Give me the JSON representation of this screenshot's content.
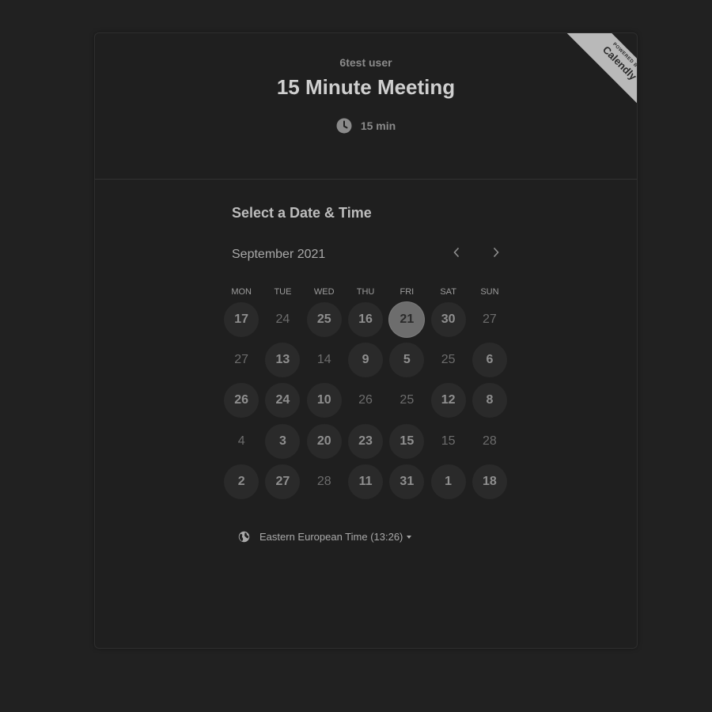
{
  "header": {
    "host_name": "6test user",
    "event_title": "15 Minute Meeting",
    "duration": "15 min",
    "duration_icon": "clock-icon"
  },
  "badge": {
    "small_text": "POWERED BY",
    "brand": "Calendly"
  },
  "scheduler": {
    "section_title": "Select a Date & Time",
    "month_label": "September 2021",
    "prev_icon": "chevron-left-icon",
    "next_icon": "chevron-right-icon",
    "weekdays": [
      "MON",
      "TUE",
      "WED",
      "THU",
      "FRI",
      "SAT",
      "SUN"
    ],
    "weeks": [
      [
        {
          "label": "17",
          "state": "available"
        },
        {
          "label": "24",
          "state": "unavailable"
        },
        {
          "label": "25",
          "state": "available"
        },
        {
          "label": "16",
          "state": "available"
        },
        {
          "label": "21",
          "state": "selected"
        },
        {
          "label": "30",
          "state": "available"
        },
        {
          "label": "27",
          "state": "unavailable"
        }
      ],
      [
        {
          "label": "27",
          "state": "unavailable"
        },
        {
          "label": "13",
          "state": "available"
        },
        {
          "label": "14",
          "state": "unavailable"
        },
        {
          "label": "9",
          "state": "available"
        },
        {
          "label": "5",
          "state": "available"
        },
        {
          "label": "25",
          "state": "unavailable"
        },
        {
          "label": "6",
          "state": "available"
        }
      ],
      [
        {
          "label": "26",
          "state": "available"
        },
        {
          "label": "24",
          "state": "available"
        },
        {
          "label": "10",
          "state": "available"
        },
        {
          "label": "26",
          "state": "unavailable"
        },
        {
          "label": "25",
          "state": "unavailable"
        },
        {
          "label": "12",
          "state": "available"
        },
        {
          "label": "8",
          "state": "available"
        }
      ],
      [
        {
          "label": "4",
          "state": "unavailable"
        },
        {
          "label": "3",
          "state": "available"
        },
        {
          "label": "20",
          "state": "available"
        },
        {
          "label": "23",
          "state": "available"
        },
        {
          "label": "15",
          "state": "available"
        },
        {
          "label": "15",
          "state": "unavailable"
        },
        {
          "label": "28",
          "state": "unavailable"
        }
      ],
      [
        {
          "label": "2",
          "state": "available"
        },
        {
          "label": "27",
          "state": "available"
        },
        {
          "label": "28",
          "state": "unavailable"
        },
        {
          "label": "11",
          "state": "available"
        },
        {
          "label": "31",
          "state": "available"
        },
        {
          "label": "1",
          "state": "available"
        },
        {
          "label": "18",
          "state": "available"
        }
      ]
    ]
  },
  "timezone": {
    "label": "Eastern European Time (13:26)",
    "icon": "globe-icon",
    "dropdown_icon": "caret-down-icon"
  },
  "colors": {
    "page_background": "#212121",
    "card_background": "#1f1f1f",
    "available_day": "#2a2a2a",
    "selected_day": "#6d6d6d",
    "badge_background": "#b9b9b9"
  }
}
